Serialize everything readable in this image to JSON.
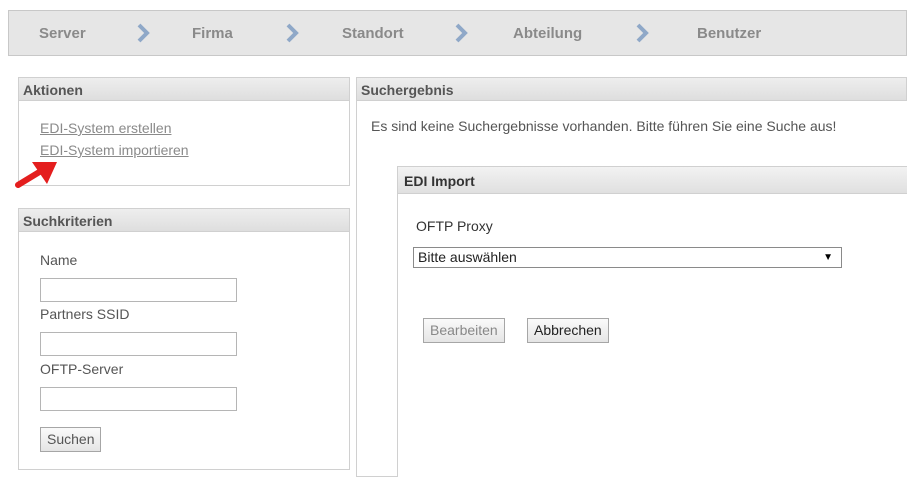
{
  "breadcrumb": {
    "items": [
      "Server",
      "Firma",
      "Standort",
      "Abteilung",
      "Benutzer"
    ]
  },
  "actions": {
    "title": "Aktionen",
    "links": [
      "EDI-System erstellen",
      "EDI-System importieren"
    ]
  },
  "search": {
    "title": "Suchkriterien",
    "fields": [
      {
        "label": "Name",
        "value": ""
      },
      {
        "label": "Partners SSID",
        "value": ""
      },
      {
        "label": "OFTP-Server",
        "value": ""
      }
    ],
    "button": "Suchen"
  },
  "results": {
    "title": "Suchergebnis",
    "message": "Es sind keine Suchergebnisse vorhanden. Bitte führen Sie eine Suche aus!"
  },
  "dialog": {
    "title": "EDI Import",
    "proxy_label": "OFTP Proxy",
    "proxy_selected": "Bitte auswählen",
    "edit_button": "Bearbeiten",
    "cancel_button": "Abbrechen"
  },
  "annotation": {
    "arrow_color": "#e41e1e"
  }
}
